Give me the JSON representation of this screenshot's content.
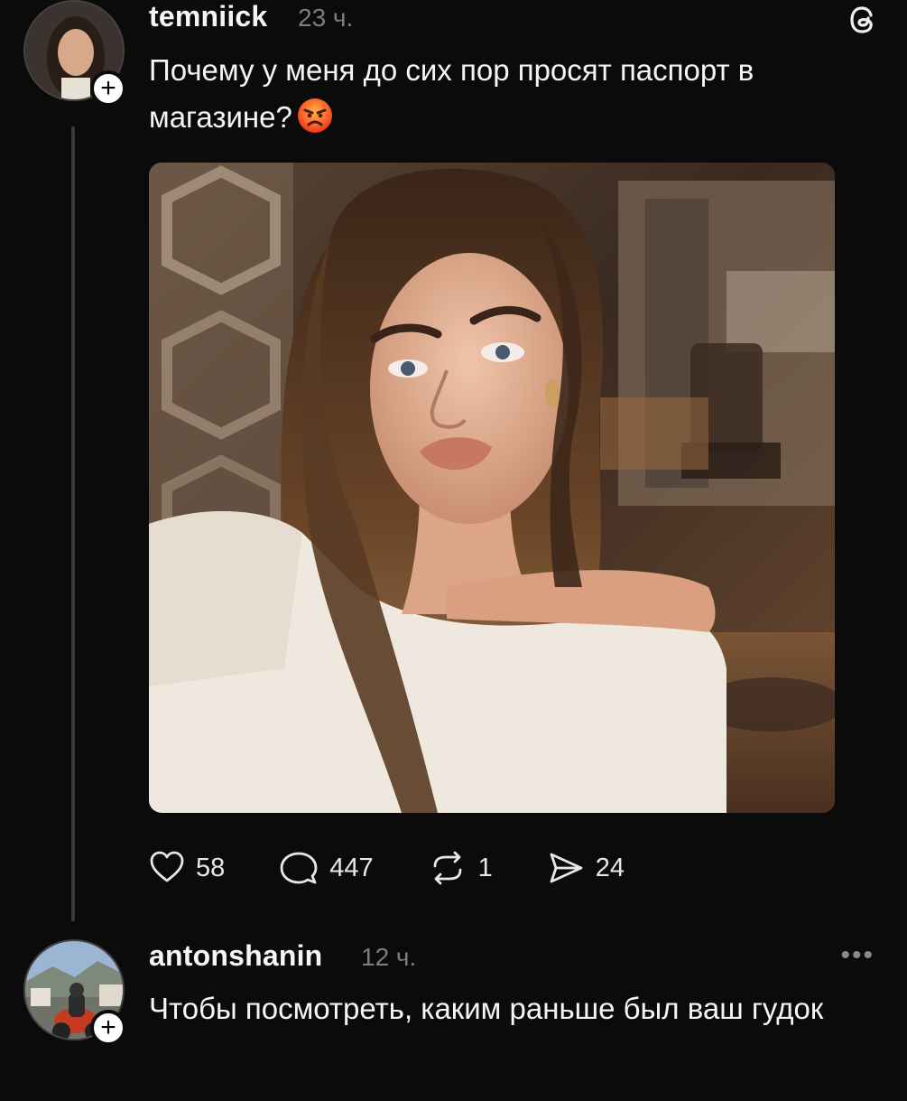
{
  "post": {
    "username": "temniick",
    "time": "23 ч.",
    "text": "Почему у меня до сих пор просят паспорт в магазине?",
    "emoji": "angry-face-icon",
    "likes": "58",
    "comments": "447",
    "reposts": "1",
    "shares": "24"
  },
  "reply": {
    "username": "antonshanin",
    "time": "12 ч.",
    "text": "Чтобы посмотреть, каким раньше был ваш гудок"
  },
  "icons": {
    "like": "heart-icon",
    "comment": "comment-bubble-icon",
    "repost": "repost-icon",
    "share": "send-icon",
    "app": "threads-logo-icon",
    "more": "more-dots-icon",
    "follow": "plus-icon"
  },
  "colors": {
    "background": "#0b0b0c",
    "text": "#f5f5f5",
    "muted": "#7d7d7d",
    "thread_line": "#3a3a3a"
  }
}
